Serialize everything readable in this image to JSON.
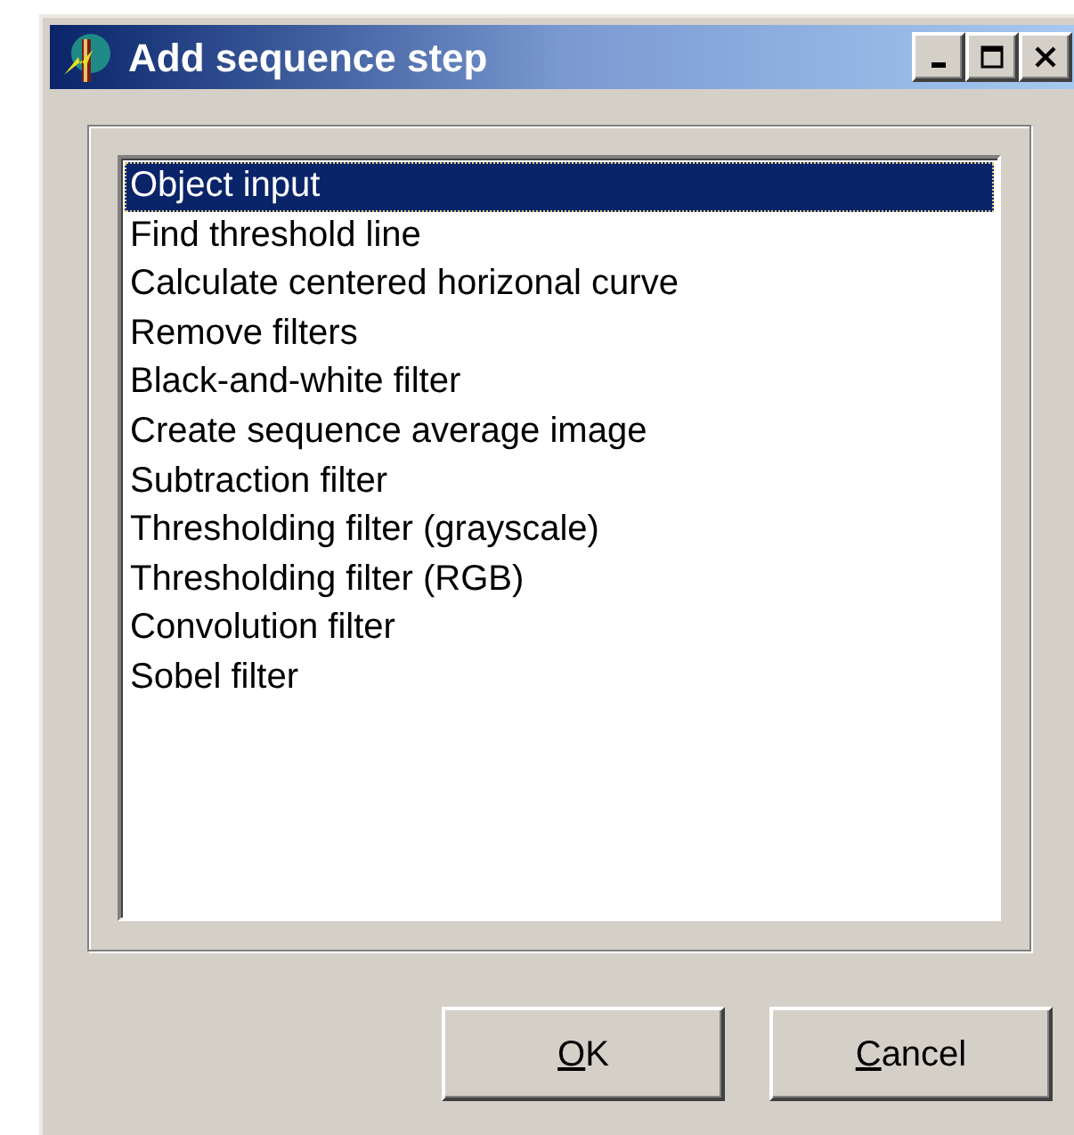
{
  "window": {
    "title": "Add sequence step",
    "controls": [
      {
        "kind": "minimize"
      },
      {
        "kind": "maximize"
      },
      {
        "kind": "close"
      }
    ]
  },
  "list": {
    "items": [
      {
        "label": "Object input",
        "selected": true
      },
      {
        "label": "Find threshold line",
        "selected": false
      },
      {
        "label": "Calculate centered horizonal curve",
        "selected": false
      },
      {
        "label": "Remove filters",
        "selected": false
      },
      {
        "label": "Black-and-white filter",
        "selected": false
      },
      {
        "label": "Create sequence average image",
        "selected": false
      },
      {
        "label": "Subtraction filter",
        "selected": false
      },
      {
        "label": "Thresholding filter (grayscale)",
        "selected": false
      },
      {
        "label": "Thresholding filter (RGB)",
        "selected": false
      },
      {
        "label": "Convolution filter",
        "selected": false
      },
      {
        "label": "Sobel filter",
        "selected": false
      }
    ]
  },
  "buttons": [
    {
      "access_key": "O",
      "rest": "K"
    },
    {
      "access_key": "C",
      "rest": "ancel"
    }
  ]
}
